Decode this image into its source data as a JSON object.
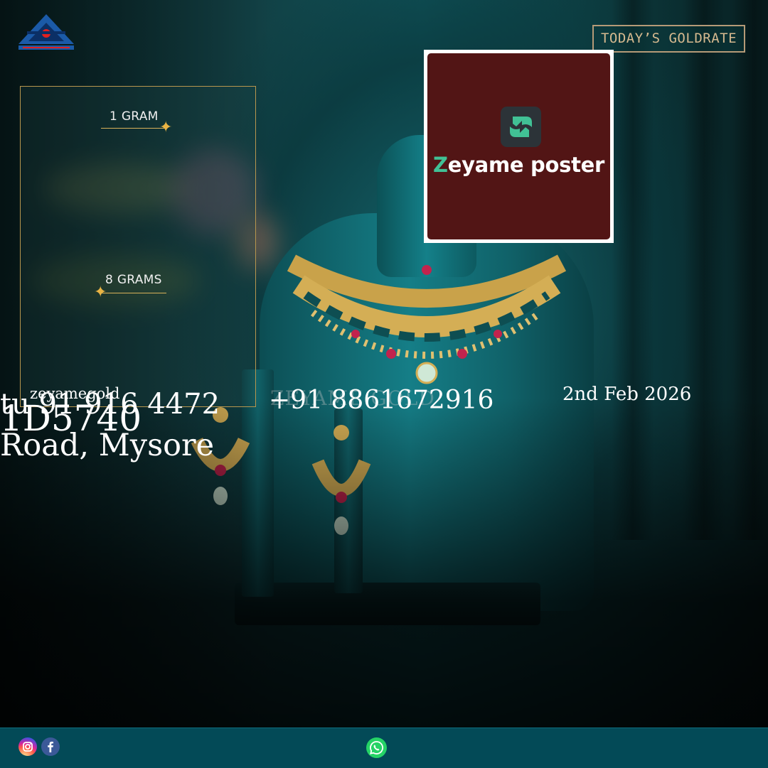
{
  "header": {
    "logo_icon": "bis-hallmark-logo-icon",
    "gold_rate_button": "TODAY’S GOLDRATE"
  },
  "poster": {
    "brand_first_letter": "Z",
    "brand_rest": "eyame poster",
    "icon": "leaf-bolt-icon"
  },
  "rates": {
    "one_gram_label": "1 GRAM",
    "eight_grams_label": "8 GRAMS"
  },
  "overlay_text": {
    "handle": "zeyamegold",
    "phone_1_fragment": "tu 91 916 4472",
    "phone_2": "+91 8861672916",
    "number_fragment": "1D5740",
    "watermark": "ZEYAME GOLD",
    "date": "2nd Feb 2026",
    "address_fragment": "Road, Mysore"
  },
  "footer": {
    "instagram_icon": "instagram-icon",
    "facebook_icon": "facebook-icon",
    "whatsapp_icon": "whatsapp-icon"
  },
  "colors": {
    "accent_gold": "#d6b98f",
    "footer_bg": "#034a57",
    "poster_bg": "#521515",
    "poster_accent": "#41c195"
  }
}
